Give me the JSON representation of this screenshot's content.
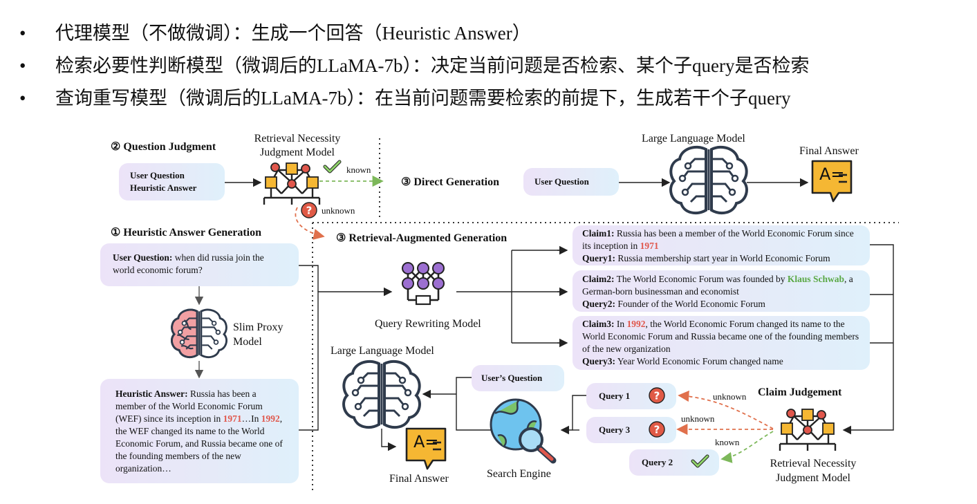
{
  "bullets": [
    {
      "marker": "•",
      "text": "代理模型（不做微调）：生成一个回答（Heuristic Answer）"
    },
    {
      "marker": "•",
      "text": "检索必要性判断模型（微调后的LLaMA-7b）：决定当前问题是否检索、某个子query是否检索"
    },
    {
      "marker": "•",
      "text": "查询重写模型（微调后的LLaMA-7b）：在当前问题需要检索的前提下，生成若干个子query"
    }
  ],
  "sections": {
    "question_judgment": "② Question Judgment",
    "direct_generation": "③ Direct Generation",
    "heuristic_generation": "① Heuristic Answer Generation",
    "rag": "③ Retrieval-Augmented Generation",
    "claim_judgement": "Claim Judgement"
  },
  "labels": {
    "rnjm_top": "Retrieval Necessity\nJudgment Model",
    "known": "known",
    "unknown": "unknown",
    "llm_top": "Large Language Model",
    "final_answer_top": "Final Answer",
    "slim_proxy": "Slim Proxy\nModel",
    "query_rewriting": "Query Rewriting Model",
    "llm_bottom": "Large Language Model",
    "final_answer_bottom": "Final Answer",
    "search_engine": "Search Engine",
    "rnjm_bottom": "Retrieval Necessity\nJudgment Model",
    "cj_unknown1": "unknown",
    "cj_unknown2": "unknown",
    "cj_known": "known",
    "answer_glyph": "A="
  },
  "boxes": {
    "uq_heuristic_line1": "User Question",
    "uq_heuristic_line2": "Heuristic Answer",
    "user_question_direct": "User Question",
    "user_question_label": "User Question:",
    "user_question_text": " when did russia join the world economic forum?",
    "heuristic_label": "Heuristic Answer:",
    "heuristic_text_a": " Russia has been a member of the World Economic Forum (WEF) since its inception in ",
    "heuristic_1971": "1971",
    "heuristic_text_b": "…In ",
    "heuristic_1992": "1992",
    "heuristic_text_c": ", the WEF changed its name to the World Economic Forum, and Russia became one of the founding members of the new organization…",
    "users_question": "User’s Question",
    "query1": "Query 1",
    "query3": "Query 3",
    "query2": "Query 2"
  },
  "claims": {
    "c1_label": "Claim1:",
    "c1_text": " Russia has been a member of the World Economic Forum since its inception in ",
    "c1_year": "1971",
    "q1_label": "Query1:",
    "q1_text": " Russia membership start year in World Economic Forum",
    "c2_label": "Claim2:",
    "c2_text_a": " The World Economic Forum was founded by ",
    "c2_name": "Klaus Schwab",
    "c2_text_b": ", a German-born businessman and economist",
    "q2_label": "Query2:",
    "q2_text": " Founder of the World Economic Forum",
    "c3_label": "Claim3:",
    "c3_text_a": " In ",
    "c3_year": "1992",
    "c3_text_b": ", the World Economic Forum changed its name to the World Economic Forum and Russia became one of the founding members of the new organization",
    "q3_label": "Query3:",
    "q3_text": " Year World Economic Forum changed name"
  },
  "colors": {
    "brain": "#2f3b4c",
    "network_box": "#f5b733",
    "network_node": "#e0574c",
    "network_purple": "#9c6fd1",
    "answer_icon": "#f5b733",
    "known_arrow": "#7db85a",
    "unknown_arrow": "#e0704c",
    "question_icon": "#e05a46",
    "highlight_red": "#e0574c",
    "highlight_green": "#5aa845"
  },
  "icons": [
    "check-icon",
    "question-icon",
    "network-icon",
    "brain-icon",
    "answer-icon",
    "globe-search-icon"
  ]
}
